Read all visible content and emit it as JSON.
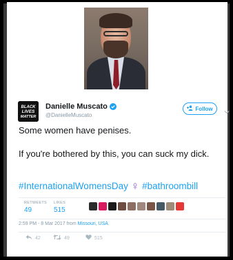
{
  "author": {
    "name": "Danielle Muscato",
    "handle": "@DanielleMuscato",
    "avatar_text": [
      "BLACK",
      "LIVES",
      "MATTER"
    ],
    "verified": true
  },
  "follow_label": "Follow",
  "tweet": {
    "line1": "Some women have penises.",
    "line2": "If you're bothered by this, you can suck my dick.",
    "hashtag1": "#InternationalWomensDay",
    "symbol": "♀",
    "hashtag2": "#bathroombill"
  },
  "stats": {
    "retweets_label": "RETWEETS",
    "retweets": "49",
    "likes_label": "LIKES",
    "likes": "515"
  },
  "liker_avatars": [
    "#2b2b2b",
    "#d81b60",
    "#1b1b1b",
    "#6d4c41",
    "#8d6e63",
    "#a1887f",
    "#795548",
    "#455a64",
    "#9e8a76",
    "#e53935"
  ],
  "timestamp": {
    "time": "2:59 PM - 8 Mar 2017 from ",
    "location": "Missouri, USA"
  },
  "actions": {
    "reply_count": "42",
    "retweet_count": "49",
    "like_count": "515"
  },
  "colors": {
    "accent": "#1da1f2",
    "text": "#14171a",
    "muted": "#8899a6",
    "venus": "#8b5ec8"
  }
}
